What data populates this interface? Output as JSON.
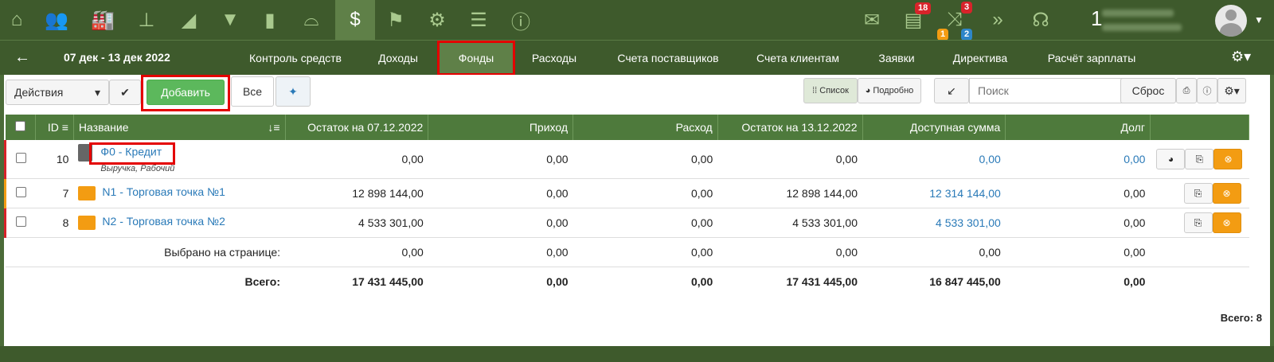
{
  "topbar": {
    "icons": [
      "home-icon",
      "users-icon",
      "factory-icon",
      "hierarchy-icon",
      "chart-area-icon",
      "filter-icon",
      "bar-chart-icon",
      "hat-icon",
      "money-bag-icon",
      "flag-icon",
      "gear-icon",
      "list-icon",
      "info-icon"
    ],
    "badge_tasks": "18",
    "badge_shuffle_top": "3",
    "badge_shuffle_orange": "1",
    "badge_shuffle_blue": "2",
    "count": "1"
  },
  "nav": {
    "date_range": "07 дек - 13 дек 2022",
    "tabs": [
      "Контроль средств",
      "Доходы",
      "Фонды",
      "Расходы",
      "Счета поставщиков",
      "Счета клиентам",
      "Заявки",
      "Директива",
      "Расчёт зарплаты"
    ],
    "active_tab": "Фонды"
  },
  "toolbar": {
    "actions": "Действия",
    "add": "Добавить",
    "all": "Все",
    "list_view": "Список",
    "detail_view": "Подробно",
    "search_placeholder": "Поиск",
    "reset": "Сброс"
  },
  "table": {
    "headers": [
      "ID",
      "Название",
      "Остаток на 07.12.2022",
      "Приход",
      "Расход",
      "Остаток на 13.12.2022",
      "Доступная сумма",
      "Долг"
    ],
    "rows": [
      {
        "id": "10",
        "name": "Ф0 - Кредит",
        "tags": "Выручка, Рабочий",
        "start": "0,00",
        "in": "0,00",
        "out": "0,00",
        "end": "0,00",
        "avail": "0,00",
        "debt": "0,00"
      },
      {
        "id": "7",
        "name": "N1 - Торговая точка №1",
        "tags": "",
        "start": "12 898 144,00",
        "in": "0,00",
        "out": "0,00",
        "end": "12 898 144,00",
        "avail": "12 314 144,00",
        "debt": "0,00"
      },
      {
        "id": "8",
        "name": "N2 - Торговая точка №2",
        "tags": "",
        "start": "4 533 301,00",
        "in": "0,00",
        "out": "0,00",
        "end": "4 533 301,00",
        "avail": "4 533 301,00",
        "debt": "0,00"
      }
    ],
    "selected_label": "Выбрано на странице:",
    "selected": [
      "0,00",
      "0,00",
      "0,00",
      "0,00",
      "0,00",
      "0,00"
    ],
    "total_label": "Всего:",
    "total": [
      "17 431 445,00",
      "0,00",
      "0,00",
      "17 431 445,00",
      "16 847 445,00",
      "0,00"
    ]
  },
  "footer_total": "Всего: 8"
}
